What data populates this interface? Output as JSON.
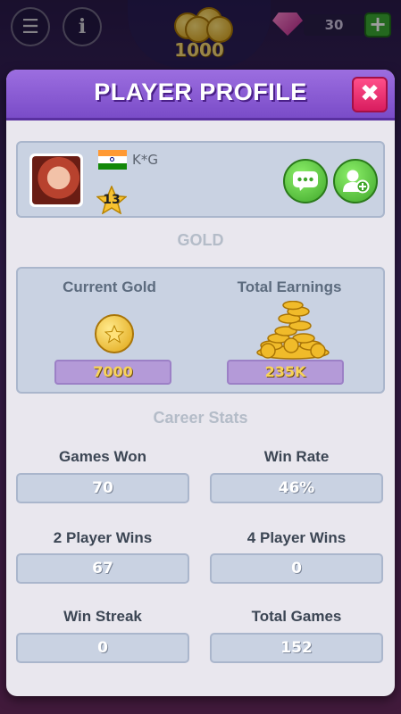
{
  "hud": {
    "coins": "1000",
    "gems": "30",
    "menu_icon": "menu-icon",
    "info_icon": "info-icon"
  },
  "dialog": {
    "title": "PLAYER PROFILE",
    "close_icon": "close-icon"
  },
  "player": {
    "name": "K*G",
    "level": "13",
    "flag": "india",
    "chat_icon": "chat-icon",
    "add_friend_icon": "add-friend-icon"
  },
  "gold": {
    "section_title": "GOLD",
    "current_label": "Current Gold",
    "current_value": "7000",
    "total_label": "Total Earnings",
    "total_value": "235K"
  },
  "career": {
    "section_title": "Career Stats",
    "stats": [
      {
        "label": "Games Won",
        "value": "70"
      },
      {
        "label": "Win Rate",
        "value": "46%"
      },
      {
        "label": "2 Player Wins",
        "value": "67"
      },
      {
        "label": "4 Player Wins",
        "value": "0"
      },
      {
        "label": "Win Streak",
        "value": "0"
      },
      {
        "label": "Total Games",
        "value": "152"
      }
    ]
  },
  "colors": {
    "header": "#7a4cc8",
    "close": "#d81d5f",
    "green": "#3fa62a",
    "gold_text": "#f7d25a"
  }
}
